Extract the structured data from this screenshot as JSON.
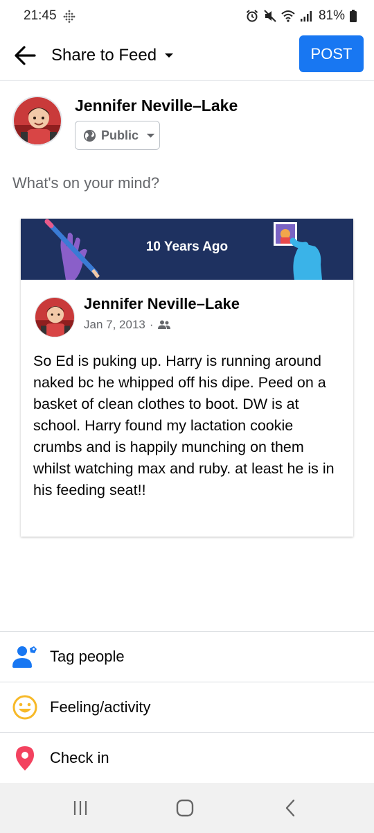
{
  "status_bar": {
    "time": "21:45",
    "battery": "81%"
  },
  "top_bar": {
    "title": "Share to Feed",
    "post_label": "POST"
  },
  "composer": {
    "author_name": "Jennifer Neville–Lake",
    "audience": "Public",
    "placeholder": "What's on your mind?"
  },
  "memory": {
    "banner_title": "10 Years Ago",
    "post": {
      "author_name": "Jennifer Neville–Lake",
      "date": "Jan 7, 2013",
      "separator": "·",
      "text": "So Ed is puking up.  Harry is running around naked bc he whipped off his dipe.  Peed on a basket of clean clothes to boot.  DW is at school.  Harry found my lactation cookie crumbs and is happily munching on them whilst watching max and ruby.  at least he is in his feeding seat!!"
    }
  },
  "actions": [
    {
      "label": "Tag people",
      "icon": "tag-people-icon"
    },
    {
      "label": "Feeling/activity",
      "icon": "smiley-icon"
    },
    {
      "label": "Check in",
      "icon": "location-pin-icon"
    }
  ],
  "colors": {
    "brand_blue": "#1877f2",
    "banner_navy": "#1e3160",
    "secondary_text": "#65676b",
    "feeling_yellow": "#f7b928",
    "checkin_red": "#f3425f"
  }
}
